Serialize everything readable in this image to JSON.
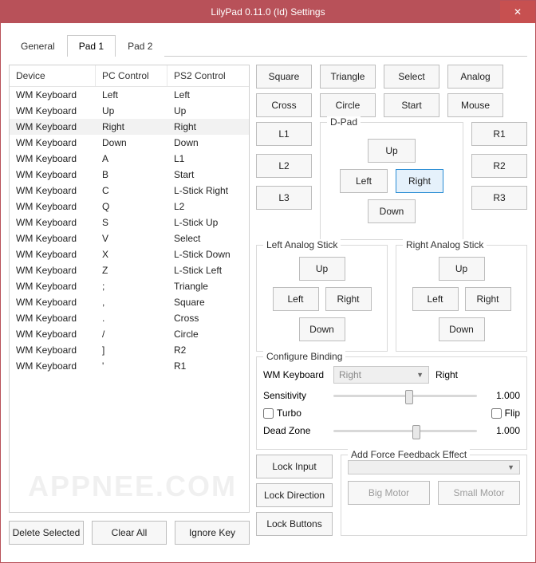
{
  "window": {
    "title": "LilyPad 0.11.0 (Id) Settings",
    "close_icon": "✕"
  },
  "tabs": [
    {
      "label": "General",
      "active": false
    },
    {
      "label": "Pad 1",
      "active": true
    },
    {
      "label": "Pad 2",
      "active": false
    }
  ],
  "table": {
    "headers": {
      "device": "Device",
      "pc": "PC Control",
      "ps2": "PS2 Control"
    },
    "rows": [
      {
        "device": "WM Keyboard",
        "pc": "Left",
        "ps2": "Left"
      },
      {
        "device": "WM Keyboard",
        "pc": "Up",
        "ps2": "Up"
      },
      {
        "device": "WM Keyboard",
        "pc": "Right",
        "ps2": "Right",
        "selected": true
      },
      {
        "device": "WM Keyboard",
        "pc": "Down",
        "ps2": "Down"
      },
      {
        "device": "WM Keyboard",
        "pc": "A",
        "ps2": "L1"
      },
      {
        "device": "WM Keyboard",
        "pc": "B",
        "ps2": "Start"
      },
      {
        "device": "WM Keyboard",
        "pc": "C",
        "ps2": "L-Stick Right"
      },
      {
        "device": "WM Keyboard",
        "pc": "Q",
        "ps2": "L2"
      },
      {
        "device": "WM Keyboard",
        "pc": "S",
        "ps2": "L-Stick Up"
      },
      {
        "device": "WM Keyboard",
        "pc": "V",
        "ps2": "Select"
      },
      {
        "device": "WM Keyboard",
        "pc": "X",
        "ps2": "L-Stick Down"
      },
      {
        "device": "WM Keyboard",
        "pc": "Z",
        "ps2": "L-Stick Left"
      },
      {
        "device": "WM Keyboard",
        "pc": ";",
        "ps2": "Triangle"
      },
      {
        "device": "WM Keyboard",
        "pc": ",",
        "ps2": "Square"
      },
      {
        "device": "WM Keyboard",
        "pc": ".",
        "ps2": "Cross"
      },
      {
        "device": "WM Keyboard",
        "pc": "/",
        "ps2": "Circle"
      },
      {
        "device": "WM Keyboard",
        "pc": "]",
        "ps2": "R2"
      },
      {
        "device": "WM Keyboard",
        "pc": "'",
        "ps2": "R1"
      }
    ]
  },
  "left_buttons": {
    "delete_selected": "Delete Selected",
    "clear_all": "Clear All",
    "ignore_key": "Ignore Key"
  },
  "face_buttons": {
    "row1": {
      "square": "Square",
      "triangle": "Triangle",
      "select": "Select",
      "analog": "Analog"
    },
    "row2": {
      "cross": "Cross",
      "circle": "Circle",
      "start": "Start",
      "mouse": "Mouse"
    }
  },
  "shoulder": {
    "l1": "L1",
    "l2": "L2",
    "l3": "L3",
    "r1": "R1",
    "r2": "R2",
    "r3": "R3"
  },
  "dpad": {
    "legend": "D-Pad",
    "up": "Up",
    "down": "Down",
    "left": "Left",
    "right": "Right"
  },
  "lstick": {
    "legend": "Left Analog Stick",
    "up": "Up",
    "down": "Down",
    "left": "Left",
    "right": "Right"
  },
  "rstick": {
    "legend": "Right Analog Stick",
    "up": "Up",
    "down": "Down",
    "left": "Left",
    "right": "Right"
  },
  "config": {
    "legend": "Configure Binding",
    "device_label": "WM Keyboard",
    "select_value": "Right",
    "binding_label": "Right",
    "sensitivity_label": "Sensitivity",
    "sensitivity_value": "1.000",
    "turbo_label": "Turbo",
    "flip_label": "Flip",
    "deadzone_label": "Dead Zone",
    "deadzone_value": "1.000"
  },
  "locks": {
    "input": "Lock Input",
    "direction": "Lock Direction",
    "buttons": "Lock Buttons"
  },
  "ffb": {
    "legend": "Add Force Feedback Effect",
    "select_value": "",
    "big_motor": "Big Motor",
    "small_motor": "Small Motor"
  },
  "watermark": "APPNEE.COM"
}
